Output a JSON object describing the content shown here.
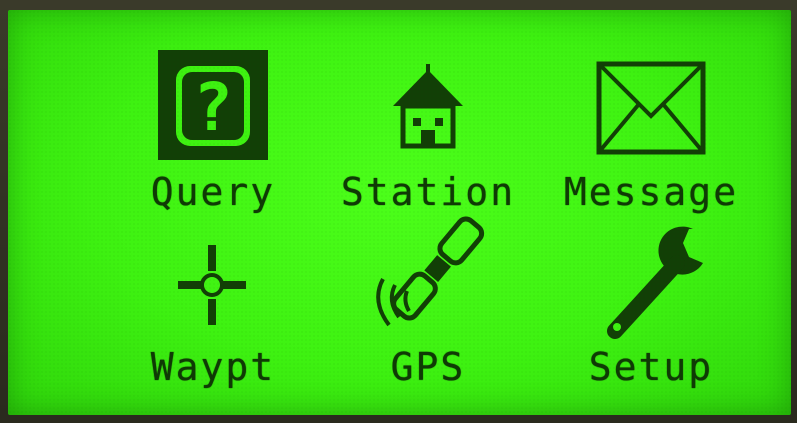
{
  "menu": {
    "items": [
      {
        "label": "Query",
        "icon": "question-icon",
        "selected": true
      },
      {
        "label": "Station",
        "icon": "house-icon",
        "selected": false
      },
      {
        "label": "Message",
        "icon": "envelope-icon",
        "selected": false
      },
      {
        "label": "Waypt",
        "icon": "crosshair-icon",
        "selected": false
      },
      {
        "label": "GPS",
        "icon": "satellite-icon",
        "selected": false
      },
      {
        "label": "Setup",
        "icon": "wrench-icon",
        "selected": false
      }
    ]
  },
  "colors": {
    "lcd_background": "#3ef211",
    "lcd_foreground": "#123f06"
  }
}
